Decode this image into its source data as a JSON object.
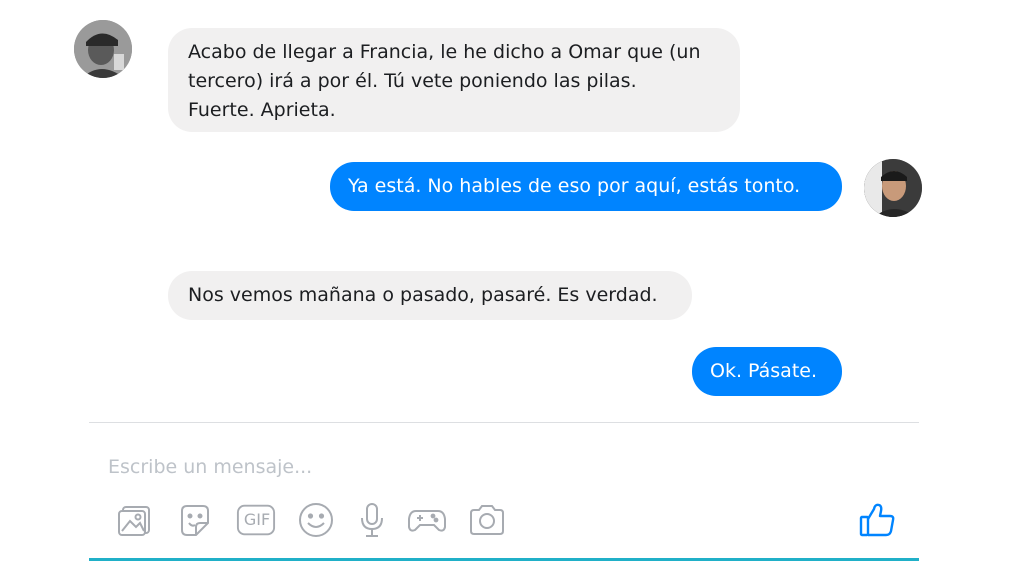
{
  "messages": [
    {
      "direction": "incoming",
      "text": "Acabo de llegar a Francia, le he dicho a Omar que (un\ntercero) irá a por él. Tú vete poniendo las pilas.\nFuerte. Aprieta."
    },
    {
      "direction": "outgoing",
      "text": "Ya está. No hables de eso por aquí, estás tonto."
    },
    {
      "direction": "incoming",
      "text": "Nos vemos mañana o pasado, pasaré. Es verdad."
    },
    {
      "direction": "outgoing",
      "text": "Ok. Pásate."
    }
  ],
  "composer": {
    "placeholder": "Escribe un mensaje...",
    "tools": [
      "image-icon",
      "sticker-icon",
      "gif-icon",
      "emoji-icon",
      "microphone-icon",
      "game-controller-icon",
      "camera-icon"
    ],
    "gif_label": "GIF",
    "like_icon": "thumbs-up-icon"
  },
  "colors": {
    "outgoing_bubble": "#0084ff",
    "incoming_bubble": "#f1f0f0",
    "accent_line": "#20b0c8",
    "icon": "#a7abb1",
    "like_icon": "#0084ff"
  }
}
